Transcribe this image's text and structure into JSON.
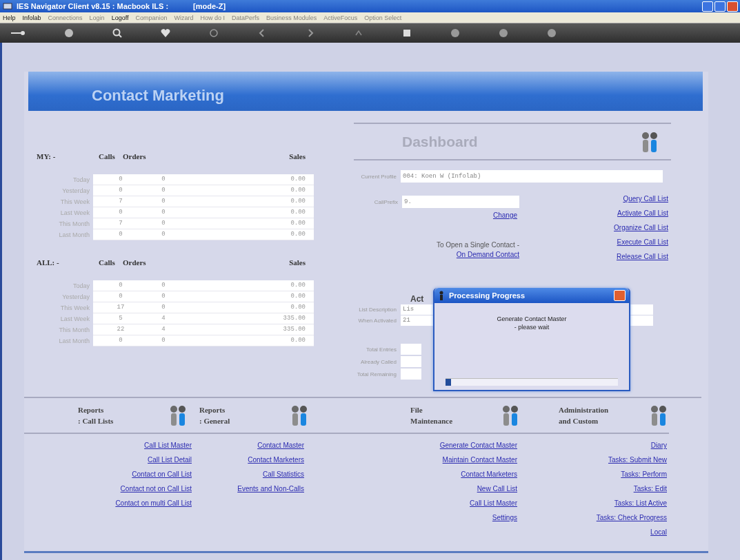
{
  "window": {
    "title": "IES Navigator Client v8.15 : Macbook ILS :",
    "mode": "[mode-Z]"
  },
  "menu": [
    {
      "label": "Help",
      "disabled": false
    },
    {
      "label": "Infolab",
      "disabled": false
    },
    {
      "label": "Connections",
      "disabled": true
    },
    {
      "label": "Login",
      "disabled": true
    },
    {
      "label": "Logoff",
      "disabled": false
    },
    {
      "label": "Companion",
      "disabled": true
    },
    {
      "label": "Wizard",
      "disabled": true
    },
    {
      "label": "How do I",
      "disabled": true
    },
    {
      "label": "DataPerfs",
      "disabled": true
    },
    {
      "label": "Business Modules",
      "disabled": true
    },
    {
      "label": "ActiveFocus",
      "disabled": true
    },
    {
      "label": "Option Select",
      "disabled": true
    }
  ],
  "page_title": "Contact Marketing",
  "stats": [
    {
      "heading": "MY: -",
      "columns": [
        "Calls",
        "Orders",
        "Sales"
      ],
      "rows": [
        {
          "label": "Today",
          "calls": "0",
          "orders": "0",
          "sales": "0.00"
        },
        {
          "label": "Yesterday",
          "calls": "0",
          "orders": "0",
          "sales": "0.00"
        },
        {
          "label": "This Week",
          "calls": "7",
          "orders": "0",
          "sales": "0.00"
        },
        {
          "label": "Last Week",
          "calls": "0",
          "orders": "0",
          "sales": "0.00"
        },
        {
          "label": "This Month",
          "calls": "7",
          "orders": "0",
          "sales": "0.00"
        },
        {
          "label": "Last Month",
          "calls": "0",
          "orders": "0",
          "sales": "0.00"
        }
      ]
    },
    {
      "heading": "ALL: -",
      "columns": [
        "Calls",
        "Orders",
        "Sales"
      ],
      "rows": [
        {
          "label": "Today",
          "calls": "0",
          "orders": "0",
          "sales": "0.00"
        },
        {
          "label": "Yesterday",
          "calls": "0",
          "orders": "0",
          "sales": "0.00"
        },
        {
          "label": "This Week",
          "calls": "17",
          "orders": "0",
          "sales": "0.00"
        },
        {
          "label": "Last Week",
          "calls": "5",
          "orders": "4",
          "sales": "335.00"
        },
        {
          "label": "This Month",
          "calls": "22",
          "orders": "4",
          "sales": "335.00"
        },
        {
          "label": "Last Month",
          "calls": "0",
          "orders": "0",
          "sales": "0.00"
        }
      ]
    }
  ],
  "dashboard": {
    "title": "Dashboard",
    "current_profile": {
      "label": "Current Profile",
      "value": "004: Koen W (Infolab)"
    },
    "call_prefix": {
      "label": "CallPrefix",
      "value": "9."
    },
    "change_link": "Change",
    "single_contact_text": "To Open a Single Contact -",
    "on_demand_link": "On Demand Contact",
    "actions": [
      "Query Call List",
      "Activate Call List",
      "Organize Call List",
      "Execute Call List",
      "Release Call List"
    ],
    "active_heading": "Act",
    "active_fields": [
      {
        "label": "List Description",
        "value": "Lis"
      },
      {
        "label": "When Activated",
        "value": "21"
      }
    ],
    "totals": [
      {
        "label": "Total Entries"
      },
      {
        "label": "Already Called"
      },
      {
        "label": "Total Remaining"
      }
    ]
  },
  "dialog": {
    "title": "Processing Progress",
    "message": [
      "Generate Contact Master",
      "- please wait"
    ],
    "progress": {
      "level": 0.03
    }
  },
  "sections": [
    {
      "title": [
        "Reports",
        ": Call Lists"
      ],
      "links": [
        "Call List Master",
        "Call List Detail",
        "Contact on Call List",
        "Contact not on Call List",
        "Contact on multi Call List"
      ]
    },
    {
      "title": [
        "Reports",
        ": General"
      ],
      "links": [
        "Contact Master",
        "Contact Marketers",
        "Call Statistics",
        "Events and Non-Calls"
      ]
    },
    {
      "title": [
        "File",
        "Maintenance"
      ],
      "links": [
        "Generate Contact Master",
        "Maintain Contact Master",
        "Contact Marketers",
        "New Call List",
        "Call List Master",
        "Settings"
      ]
    },
    {
      "title": [
        "Administration",
        "and Custom"
      ],
      "links": [
        "Diary",
        "Tasks: Submit New",
        "Tasks: Perform",
        "Tasks: Edit",
        "Tasks: List Active",
        "Tasks: Check Progress",
        "Local"
      ]
    }
  ]
}
